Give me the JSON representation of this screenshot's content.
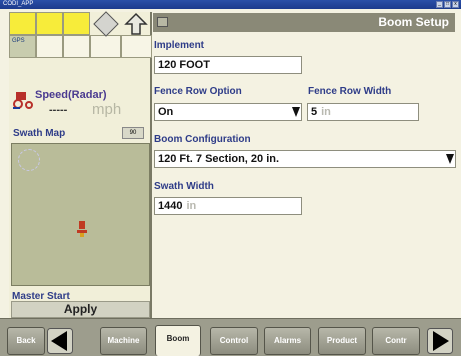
{
  "window": {
    "title": "CODI_APP",
    "controls": [
      "_",
      "□",
      "x"
    ]
  },
  "left": {
    "gps_label": "GPS",
    "speed": {
      "label": "Speed(Radar)",
      "value": "-----",
      "unit": "mph"
    },
    "swath_map": {
      "title": "Swath Map",
      "badge": "90"
    },
    "master_start": {
      "title": "Master Start",
      "button": "Apply"
    }
  },
  "panel": {
    "title": "Boom Setup",
    "implement": {
      "label": "Implement",
      "value": "120 FOOT"
    },
    "fence_row_option": {
      "label": "Fence Row Option",
      "value": "On"
    },
    "fence_row_width": {
      "label": "Fence Row Width",
      "value": "5",
      "unit": "in"
    },
    "boom_configuration": {
      "label": "Boom Configuration",
      "value": "120 Ft. 7 Section, 20 in."
    },
    "swath_width": {
      "label": "Swath Width",
      "value": "1440",
      "unit": "in"
    }
  },
  "tabs": {
    "back": "Back",
    "machine": "Machine",
    "boom": "Boom",
    "control": "Control",
    "alarms": "Alarms",
    "product": "Product",
    "contr": "Contr"
  },
  "colors": {
    "label_blue": "#2e3c88",
    "grid_yellow": "#f7ec3a",
    "header_gray": "#8a8977"
  }
}
